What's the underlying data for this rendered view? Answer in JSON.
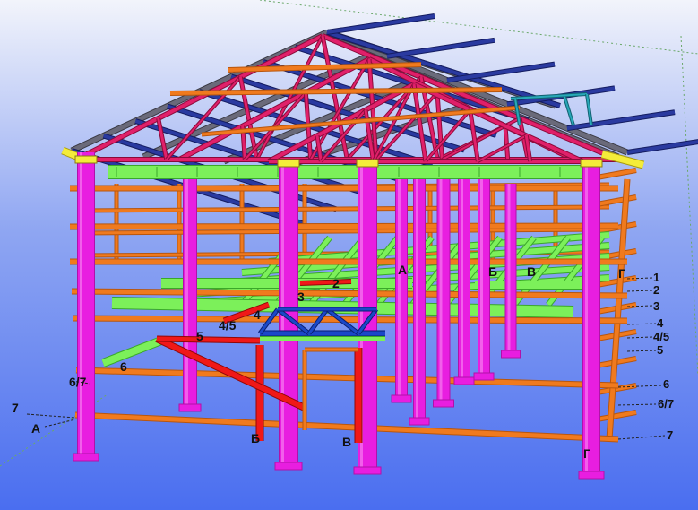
{
  "viewport": {
    "name": "3d-model-viewport",
    "background": {
      "top": "#f2f4fb",
      "mid": "#8fa6f2",
      "bottom": "#4a6ef0"
    }
  },
  "colors": {
    "column": "#e81ee0",
    "column_dark": "#b012a8",
    "beam_orange": "#f07a1e",
    "beam_orange_dark": "#b8560e",
    "beam_green": "#7cf05a",
    "beam_green_dark": "#3aa82a",
    "truss_red": "#e0206a",
    "rafter_gray": "#6a6a7a",
    "purlin_blue": "#2a3aa0",
    "eave_yellow": "#f4ec3a",
    "red_member": "#f01818",
    "bracing_blue": "#1a48c8",
    "bracing_cyan": "#28a8b8",
    "leader": "#222222"
  },
  "grid_labels": {
    "right_numbers": [
      "1",
      "2",
      "3",
      "4",
      "4/5",
      "5",
      "6",
      "6/7",
      "7"
    ],
    "left_numbers": [
      "6",
      "6/7",
      "7"
    ],
    "inner_numbers": [
      "2",
      "3",
      "4",
      "4/5",
      "5"
    ],
    "letters_top": [
      "А",
      "Б",
      "В",
      "Г"
    ],
    "letters_bottom": [
      "А",
      "Б",
      "В",
      "Г"
    ]
  }
}
